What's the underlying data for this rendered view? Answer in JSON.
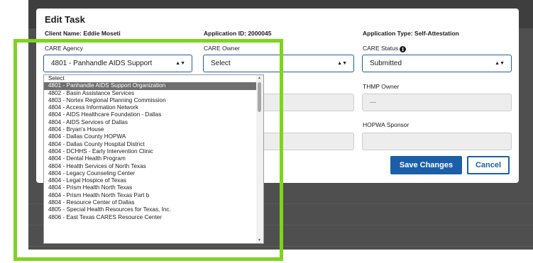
{
  "modal": {
    "title": "Edit Task",
    "client_name": "Client Name: Eddie Moseti",
    "application_id": "Application ID: 2000045",
    "application_type": "Application Type: Self-Attestation"
  },
  "fields": {
    "care_agency": {
      "label": "CARE Agency",
      "value": "4801 - Panhandle AIDS Support Organization"
    },
    "care_owner": {
      "label": "CARE Owner",
      "value": "Select"
    },
    "care_status": {
      "label": "CARE Status",
      "value": "Submitted"
    },
    "thmp_owner": {
      "label": "THMP Owner",
      "value": "---"
    },
    "hopwa_sponsor": {
      "label": "HOPWA Sponsor",
      "value": ""
    }
  },
  "buttons": {
    "save": "Save Changes",
    "cancel": "Cancel"
  },
  "dropdown": {
    "selected_index": 1,
    "options": [
      "Select",
      "4801 - Panhandle AIDS Support Organization",
      "4802 - Basin Assistance Services",
      "4803 - Nortex Regional Planning Commission",
      "4804 - Access Information Network",
      "4804 - AIDS Healthcare Foundation - Dallas",
      "4804 - AIDS Services of Dallas",
      "4804 - Bryan's House",
      "4804 - Dallas County HOPWA",
      "4804 - Dallas County Hospital District",
      "4804 - DCHHS - Early Intervention Clinic",
      "4804 - Dental Health Program",
      "4804 - Health Services of North Texas",
      "4804 - Legacy Counseling Center",
      "4804 - Legal Hospice of Texas",
      "4804 - Prism Health North Texas",
      "4804 - Prism Health North Texas Part b",
      "4804 - Resource Center of Dallas",
      "4805 - Special Health Resources for Texas, Inc.",
      "4806 - East Texas CARES Resource Center"
    ]
  },
  "colors": {
    "primary": "#1b5fa8",
    "highlight": "#7ed321",
    "overlay": "#4f4f4f"
  }
}
